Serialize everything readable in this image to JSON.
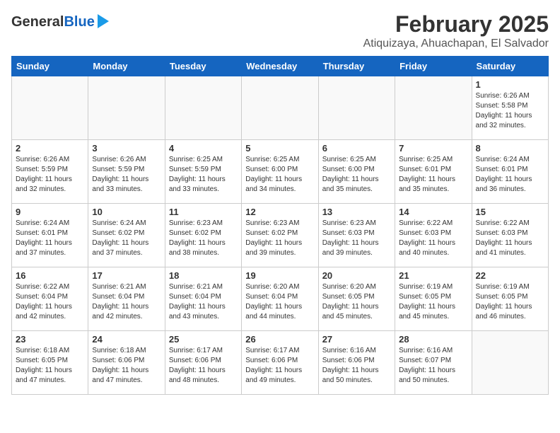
{
  "logo": {
    "general": "General",
    "blue": "Blue"
  },
  "title": "February 2025",
  "location": "Atiquizaya, Ahuachapan, El Salvador",
  "days_of_week": [
    "Sunday",
    "Monday",
    "Tuesday",
    "Wednesday",
    "Thursday",
    "Friday",
    "Saturday"
  ],
  "weeks": [
    [
      {
        "day": "",
        "info": ""
      },
      {
        "day": "",
        "info": ""
      },
      {
        "day": "",
        "info": ""
      },
      {
        "day": "",
        "info": ""
      },
      {
        "day": "",
        "info": ""
      },
      {
        "day": "",
        "info": ""
      },
      {
        "day": "1",
        "info": "Sunrise: 6:26 AM\nSunset: 5:58 PM\nDaylight: 11 hours\nand 32 minutes."
      }
    ],
    [
      {
        "day": "2",
        "info": "Sunrise: 6:26 AM\nSunset: 5:59 PM\nDaylight: 11 hours\nand 32 minutes."
      },
      {
        "day": "3",
        "info": "Sunrise: 6:26 AM\nSunset: 5:59 PM\nDaylight: 11 hours\nand 33 minutes."
      },
      {
        "day": "4",
        "info": "Sunrise: 6:25 AM\nSunset: 5:59 PM\nDaylight: 11 hours\nand 33 minutes."
      },
      {
        "day": "5",
        "info": "Sunrise: 6:25 AM\nSunset: 6:00 PM\nDaylight: 11 hours\nand 34 minutes."
      },
      {
        "day": "6",
        "info": "Sunrise: 6:25 AM\nSunset: 6:00 PM\nDaylight: 11 hours\nand 35 minutes."
      },
      {
        "day": "7",
        "info": "Sunrise: 6:25 AM\nSunset: 6:01 PM\nDaylight: 11 hours\nand 35 minutes."
      },
      {
        "day": "8",
        "info": "Sunrise: 6:24 AM\nSunset: 6:01 PM\nDaylight: 11 hours\nand 36 minutes."
      }
    ],
    [
      {
        "day": "9",
        "info": "Sunrise: 6:24 AM\nSunset: 6:01 PM\nDaylight: 11 hours\nand 37 minutes."
      },
      {
        "day": "10",
        "info": "Sunrise: 6:24 AM\nSunset: 6:02 PM\nDaylight: 11 hours\nand 37 minutes."
      },
      {
        "day": "11",
        "info": "Sunrise: 6:23 AM\nSunset: 6:02 PM\nDaylight: 11 hours\nand 38 minutes."
      },
      {
        "day": "12",
        "info": "Sunrise: 6:23 AM\nSunset: 6:02 PM\nDaylight: 11 hours\nand 39 minutes."
      },
      {
        "day": "13",
        "info": "Sunrise: 6:23 AM\nSunset: 6:03 PM\nDaylight: 11 hours\nand 39 minutes."
      },
      {
        "day": "14",
        "info": "Sunrise: 6:22 AM\nSunset: 6:03 PM\nDaylight: 11 hours\nand 40 minutes."
      },
      {
        "day": "15",
        "info": "Sunrise: 6:22 AM\nSunset: 6:03 PM\nDaylight: 11 hours\nand 41 minutes."
      }
    ],
    [
      {
        "day": "16",
        "info": "Sunrise: 6:22 AM\nSunset: 6:04 PM\nDaylight: 11 hours\nand 42 minutes."
      },
      {
        "day": "17",
        "info": "Sunrise: 6:21 AM\nSunset: 6:04 PM\nDaylight: 11 hours\nand 42 minutes."
      },
      {
        "day": "18",
        "info": "Sunrise: 6:21 AM\nSunset: 6:04 PM\nDaylight: 11 hours\nand 43 minutes."
      },
      {
        "day": "19",
        "info": "Sunrise: 6:20 AM\nSunset: 6:04 PM\nDaylight: 11 hours\nand 44 minutes."
      },
      {
        "day": "20",
        "info": "Sunrise: 6:20 AM\nSunset: 6:05 PM\nDaylight: 11 hours\nand 45 minutes."
      },
      {
        "day": "21",
        "info": "Sunrise: 6:19 AM\nSunset: 6:05 PM\nDaylight: 11 hours\nand 45 minutes."
      },
      {
        "day": "22",
        "info": "Sunrise: 6:19 AM\nSunset: 6:05 PM\nDaylight: 11 hours\nand 46 minutes."
      }
    ],
    [
      {
        "day": "23",
        "info": "Sunrise: 6:18 AM\nSunset: 6:05 PM\nDaylight: 11 hours\nand 47 minutes."
      },
      {
        "day": "24",
        "info": "Sunrise: 6:18 AM\nSunset: 6:06 PM\nDaylight: 11 hours\nand 47 minutes."
      },
      {
        "day": "25",
        "info": "Sunrise: 6:17 AM\nSunset: 6:06 PM\nDaylight: 11 hours\nand 48 minutes."
      },
      {
        "day": "26",
        "info": "Sunrise: 6:17 AM\nSunset: 6:06 PM\nDaylight: 11 hours\nand 49 minutes."
      },
      {
        "day": "27",
        "info": "Sunrise: 6:16 AM\nSunset: 6:06 PM\nDaylight: 11 hours\nand 50 minutes."
      },
      {
        "day": "28",
        "info": "Sunrise: 6:16 AM\nSunset: 6:07 PM\nDaylight: 11 hours\nand 50 minutes."
      },
      {
        "day": "",
        "info": ""
      }
    ]
  ]
}
